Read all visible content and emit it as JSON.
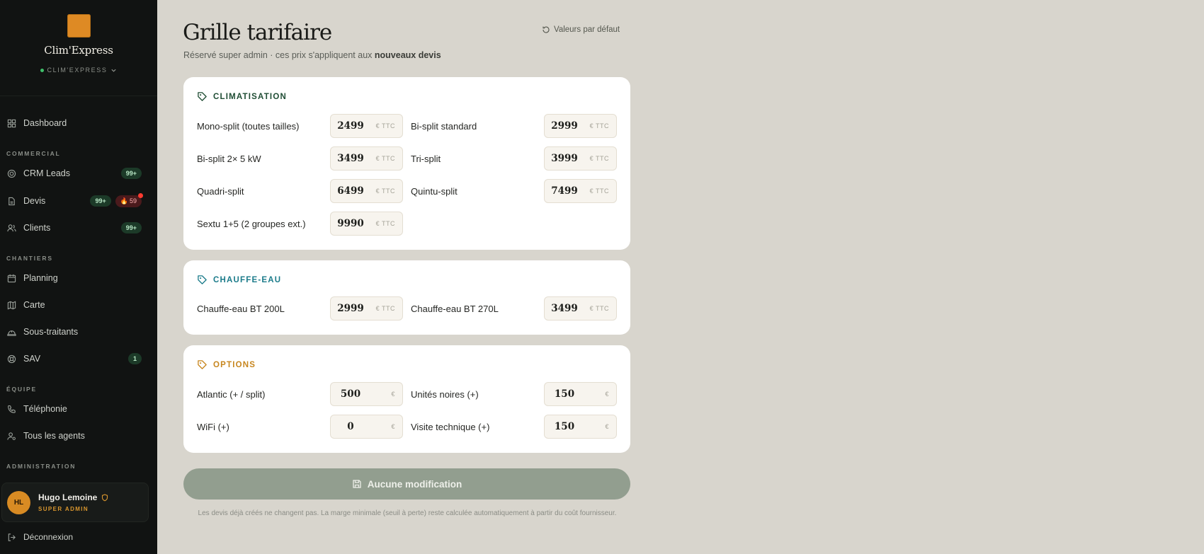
{
  "brand": {
    "name": "Clim'Express",
    "org": "CLIM'EXPRESS"
  },
  "nav": {
    "dashboard": "Dashboard",
    "sec_commercial": "COMMERCIAL",
    "crm": "CRM Leads",
    "crm_badge": "99+",
    "devis": "Devis",
    "devis_badge": "99+",
    "devis_alert": "59",
    "clients": "Clients",
    "clients_badge": "99+",
    "sec_chantiers": "CHANTIERS",
    "planning": "Planning",
    "carte": "Carte",
    "soustraitants": "Sous-traitants",
    "sav": "SAV",
    "sav_badge": "1",
    "sec_equipe": "ÉQUIPE",
    "telephonie": "Téléphonie",
    "agents": "Tous les agents",
    "sec_admin": "ADMINISTRATION"
  },
  "user": {
    "initials": "HL",
    "name": "Hugo Lemoine",
    "role": "SUPER ADMIN"
  },
  "logout": "Déconnexion",
  "page": {
    "title": "Grille tarifaire",
    "subtitle_pre": "Réservé super admin · ces prix s'appliquent aux ",
    "subtitle_bold": "nouveaux devis",
    "reset": "Valeurs par défaut"
  },
  "sections": {
    "clim": {
      "title": "CLIMATISATION",
      "color": "#1f4d34",
      "items": [
        {
          "label": "Mono-split (toutes tailles)",
          "value": "2499",
          "unit": "€ TTC"
        },
        {
          "label": "Bi-split standard",
          "value": "2999",
          "unit": "€ TTC"
        },
        {
          "label": "Bi-split 2× 5 kW",
          "value": "3499",
          "unit": "€ TTC"
        },
        {
          "label": "Tri-split",
          "value": "3999",
          "unit": "€ TTC"
        },
        {
          "label": "Quadri-split",
          "value": "6499",
          "unit": "€ TTC"
        },
        {
          "label": "Quintu-split",
          "value": "7499",
          "unit": "€ TTC"
        },
        {
          "label": "Sextu 1+5 (2 groupes ext.)",
          "value": "9990",
          "unit": "€ TTC"
        }
      ]
    },
    "eau": {
      "title": "CHAUFFE-EAU",
      "color": "#1b7b8a",
      "items": [
        {
          "label": "Chauffe-eau BT 200L",
          "value": "2999",
          "unit": "€ TTC"
        },
        {
          "label": "Chauffe-eau BT 270L",
          "value": "3499",
          "unit": "€ TTC"
        }
      ]
    },
    "opt": {
      "title": "OPTIONS",
      "color": "#c7861e",
      "items": [
        {
          "label": "Atlantic (+ / split)",
          "value": "500",
          "unit": "€"
        },
        {
          "label": "Unités noires (+)",
          "value": "150",
          "unit": "€"
        },
        {
          "label": "WiFi (+)",
          "value": "0",
          "unit": "€"
        },
        {
          "label": "Visite technique (+)",
          "value": "150",
          "unit": "€"
        }
      ]
    }
  },
  "save": "Aucune modification",
  "footnote": "Les devis déjà créés ne changent pas. La marge minimale (seuil à perte) reste calculée automatiquement à partir du coût fournisseur."
}
